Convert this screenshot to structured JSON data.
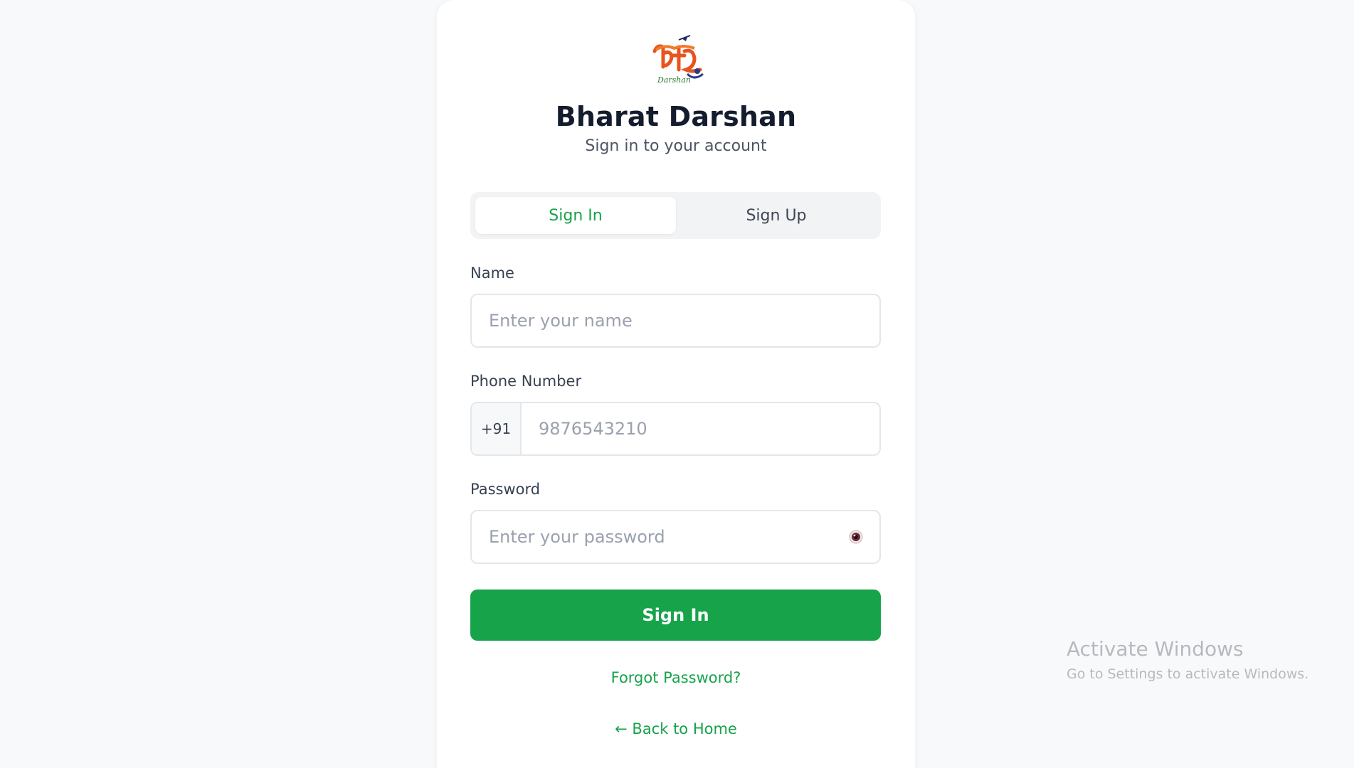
{
  "app": {
    "title": "Bharat Darshan",
    "subtitle": "Sign in to your account",
    "logo_text": "Darshan"
  },
  "tabs": [
    {
      "label": "Sign In",
      "active": true
    },
    {
      "label": "Sign Up",
      "active": false
    }
  ],
  "form": {
    "name": {
      "label": "Name",
      "placeholder": "Enter your name",
      "value": ""
    },
    "phone": {
      "label": "Phone Number",
      "prefix": "+91",
      "placeholder": "9876543210",
      "value": ""
    },
    "password": {
      "label": "Password",
      "placeholder": "Enter your password",
      "value": "",
      "toggle_icon": "eye-icon"
    },
    "submit_label": "Sign In"
  },
  "links": {
    "forgot_password": "Forgot Password?",
    "back_home": "← Back to Home"
  },
  "watermark": {
    "title": "Activate Windows",
    "subtitle": "Go to Settings to activate Windows."
  },
  "colors": {
    "accent": "#16a34a",
    "background": "#f8f9fb",
    "card": "#ffffff",
    "title": "#141c2e"
  }
}
